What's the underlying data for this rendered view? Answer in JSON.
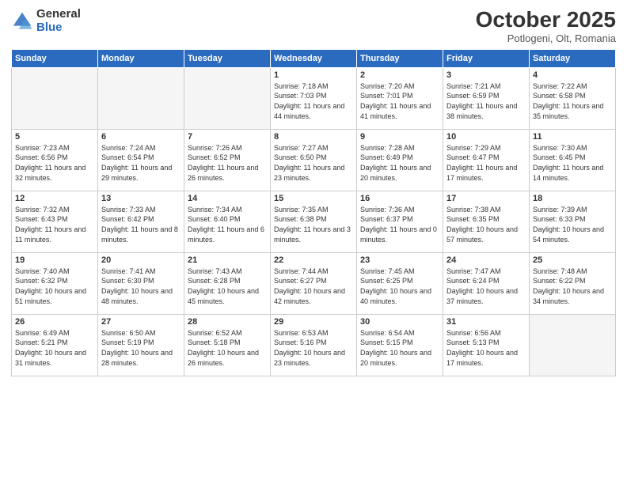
{
  "header": {
    "logo_general": "General",
    "logo_blue": "Blue",
    "month_title": "October 2025",
    "location": "Potlogeni, Olt, Romania"
  },
  "days_of_week": [
    "Sunday",
    "Monday",
    "Tuesday",
    "Wednesday",
    "Thursday",
    "Friday",
    "Saturday"
  ],
  "weeks": [
    [
      {
        "num": "",
        "empty": true
      },
      {
        "num": "",
        "empty": true
      },
      {
        "num": "",
        "empty": true
      },
      {
        "num": "1",
        "sunrise": "7:18 AM",
        "sunset": "7:03 PM",
        "daylight": "11 hours and 44 minutes."
      },
      {
        "num": "2",
        "sunrise": "7:20 AM",
        "sunset": "7:01 PM",
        "daylight": "11 hours and 41 minutes."
      },
      {
        "num": "3",
        "sunrise": "7:21 AM",
        "sunset": "6:59 PM",
        "daylight": "11 hours and 38 minutes."
      },
      {
        "num": "4",
        "sunrise": "7:22 AM",
        "sunset": "6:58 PM",
        "daylight": "11 hours and 35 minutes."
      }
    ],
    [
      {
        "num": "5",
        "sunrise": "7:23 AM",
        "sunset": "6:56 PM",
        "daylight": "11 hours and 32 minutes."
      },
      {
        "num": "6",
        "sunrise": "7:24 AM",
        "sunset": "6:54 PM",
        "daylight": "11 hours and 29 minutes."
      },
      {
        "num": "7",
        "sunrise": "7:26 AM",
        "sunset": "6:52 PM",
        "daylight": "11 hours and 26 minutes."
      },
      {
        "num": "8",
        "sunrise": "7:27 AM",
        "sunset": "6:50 PM",
        "daylight": "11 hours and 23 minutes."
      },
      {
        "num": "9",
        "sunrise": "7:28 AM",
        "sunset": "6:49 PM",
        "daylight": "11 hours and 20 minutes."
      },
      {
        "num": "10",
        "sunrise": "7:29 AM",
        "sunset": "6:47 PM",
        "daylight": "11 hours and 17 minutes."
      },
      {
        "num": "11",
        "sunrise": "7:30 AM",
        "sunset": "6:45 PM",
        "daylight": "11 hours and 14 minutes."
      }
    ],
    [
      {
        "num": "12",
        "sunrise": "7:32 AM",
        "sunset": "6:43 PM",
        "daylight": "11 hours and 11 minutes."
      },
      {
        "num": "13",
        "sunrise": "7:33 AM",
        "sunset": "6:42 PM",
        "daylight": "11 hours and 8 minutes."
      },
      {
        "num": "14",
        "sunrise": "7:34 AM",
        "sunset": "6:40 PM",
        "daylight": "11 hours and 6 minutes."
      },
      {
        "num": "15",
        "sunrise": "7:35 AM",
        "sunset": "6:38 PM",
        "daylight": "11 hours and 3 minutes."
      },
      {
        "num": "16",
        "sunrise": "7:36 AM",
        "sunset": "6:37 PM",
        "daylight": "11 hours and 0 minutes."
      },
      {
        "num": "17",
        "sunrise": "7:38 AM",
        "sunset": "6:35 PM",
        "daylight": "10 hours and 57 minutes."
      },
      {
        "num": "18",
        "sunrise": "7:39 AM",
        "sunset": "6:33 PM",
        "daylight": "10 hours and 54 minutes."
      }
    ],
    [
      {
        "num": "19",
        "sunrise": "7:40 AM",
        "sunset": "6:32 PM",
        "daylight": "10 hours and 51 minutes."
      },
      {
        "num": "20",
        "sunrise": "7:41 AM",
        "sunset": "6:30 PM",
        "daylight": "10 hours and 48 minutes."
      },
      {
        "num": "21",
        "sunrise": "7:43 AM",
        "sunset": "6:28 PM",
        "daylight": "10 hours and 45 minutes."
      },
      {
        "num": "22",
        "sunrise": "7:44 AM",
        "sunset": "6:27 PM",
        "daylight": "10 hours and 42 minutes."
      },
      {
        "num": "23",
        "sunrise": "7:45 AM",
        "sunset": "6:25 PM",
        "daylight": "10 hours and 40 minutes."
      },
      {
        "num": "24",
        "sunrise": "7:47 AM",
        "sunset": "6:24 PM",
        "daylight": "10 hours and 37 minutes."
      },
      {
        "num": "25",
        "sunrise": "7:48 AM",
        "sunset": "6:22 PM",
        "daylight": "10 hours and 34 minutes."
      }
    ],
    [
      {
        "num": "26",
        "sunrise": "6:49 AM",
        "sunset": "5:21 PM",
        "daylight": "10 hours and 31 minutes."
      },
      {
        "num": "27",
        "sunrise": "6:50 AM",
        "sunset": "5:19 PM",
        "daylight": "10 hours and 28 minutes."
      },
      {
        "num": "28",
        "sunrise": "6:52 AM",
        "sunset": "5:18 PM",
        "daylight": "10 hours and 26 minutes."
      },
      {
        "num": "29",
        "sunrise": "6:53 AM",
        "sunset": "5:16 PM",
        "daylight": "10 hours and 23 minutes."
      },
      {
        "num": "30",
        "sunrise": "6:54 AM",
        "sunset": "5:15 PM",
        "daylight": "10 hours and 20 minutes."
      },
      {
        "num": "31",
        "sunrise": "6:56 AM",
        "sunset": "5:13 PM",
        "daylight": "10 hours and 17 minutes."
      },
      {
        "num": "",
        "empty": true
      }
    ]
  ]
}
